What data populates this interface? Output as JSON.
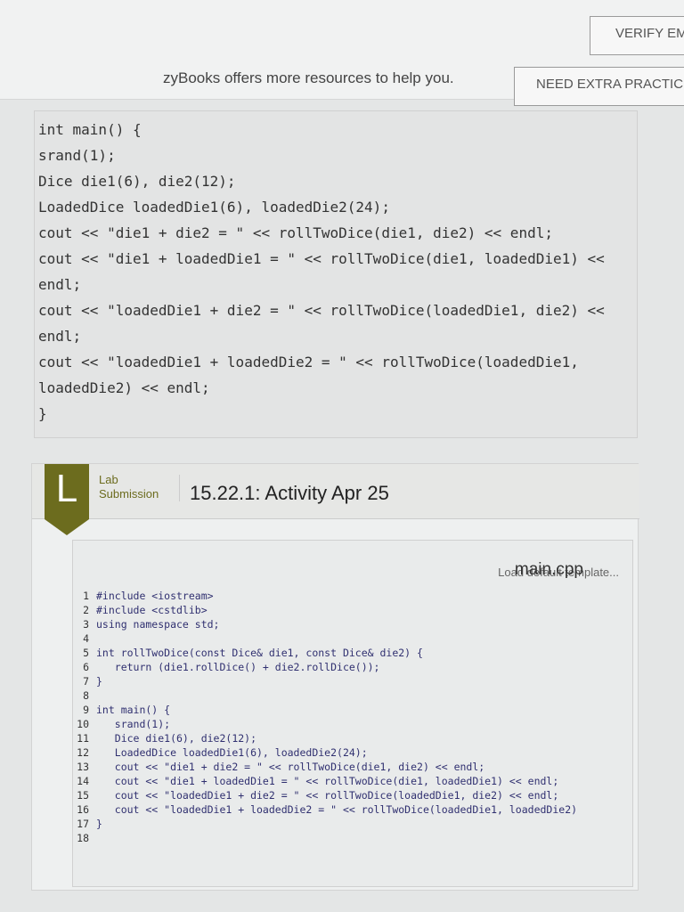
{
  "header": {
    "verify_label": "VERIFY EM",
    "resources_text": "zyBooks offers more resources to help you.",
    "extra_practice_label": "NEED EXTRA PRACTICE"
  },
  "code_snippet": [
    "int main() {",
    "srand(1);",
    "Dice die1(6), die2(12);",
    "LoadedDice loadedDie1(6), loadedDie2(24);",
    "cout << \"die1 + die2 = \" << rollTwoDice(die1, die2) << endl;",
    "cout << \"die1 + loadedDie1 = \" << rollTwoDice(die1, loadedDie1) <<",
    "endl;",
    "cout << \"loadedDie1 + die2 = \" << rollTwoDice(loadedDie1, die2) <<",
    "endl;",
    "cout << \"loadedDie1 + loadedDie2 = \" << rollTwoDice(loadedDie1,",
    "loadedDie2) << endl;",
    "}"
  ],
  "lab": {
    "badge": "L",
    "type_line1": "Lab",
    "type_line2": "Submission",
    "title": "15.22.1: Activity Apr 25",
    "load_template": "Load default template...",
    "filename": "main.cpp",
    "lines": [
      {
        "n": "1",
        "code": "#include <iostream>"
      },
      {
        "n": "2",
        "code": "#include <cstdlib>"
      },
      {
        "n": "3",
        "code": "using namespace std;"
      },
      {
        "n": "4",
        "code": ""
      },
      {
        "n": "5",
        "code": "int rollTwoDice(const Dice& die1, const Dice& die2) {"
      },
      {
        "n": "6",
        "code": "   return (die1.rollDice() + die2.rollDice());"
      },
      {
        "n": "7",
        "code": "}"
      },
      {
        "n": "8",
        "code": ""
      },
      {
        "n": "9",
        "code": "int main() {"
      },
      {
        "n": "10",
        "code": "   srand(1);"
      },
      {
        "n": "11",
        "code": "   Dice die1(6), die2(12);"
      },
      {
        "n": "12",
        "code": "   LoadedDice loadedDie1(6), loadedDie2(24);"
      },
      {
        "n": "13",
        "code": "   cout << \"die1 + die2 = \" << rollTwoDice(die1, die2) << endl;"
      },
      {
        "n": "14",
        "code": "   cout << \"die1 + loadedDie1 = \" << rollTwoDice(die1, loadedDie1) << endl;"
      },
      {
        "n": "15",
        "code": "   cout << \"loadedDie1 + die2 = \" << rollTwoDice(loadedDie1, die2) << endl;"
      },
      {
        "n": "16",
        "code": "   cout << \"loadedDie1 + loadedDie2 = \" << rollTwoDice(loadedDie1, loadedDie2)"
      },
      {
        "n": "17",
        "code": "}"
      },
      {
        "n": "18",
        "code": ""
      }
    ]
  }
}
